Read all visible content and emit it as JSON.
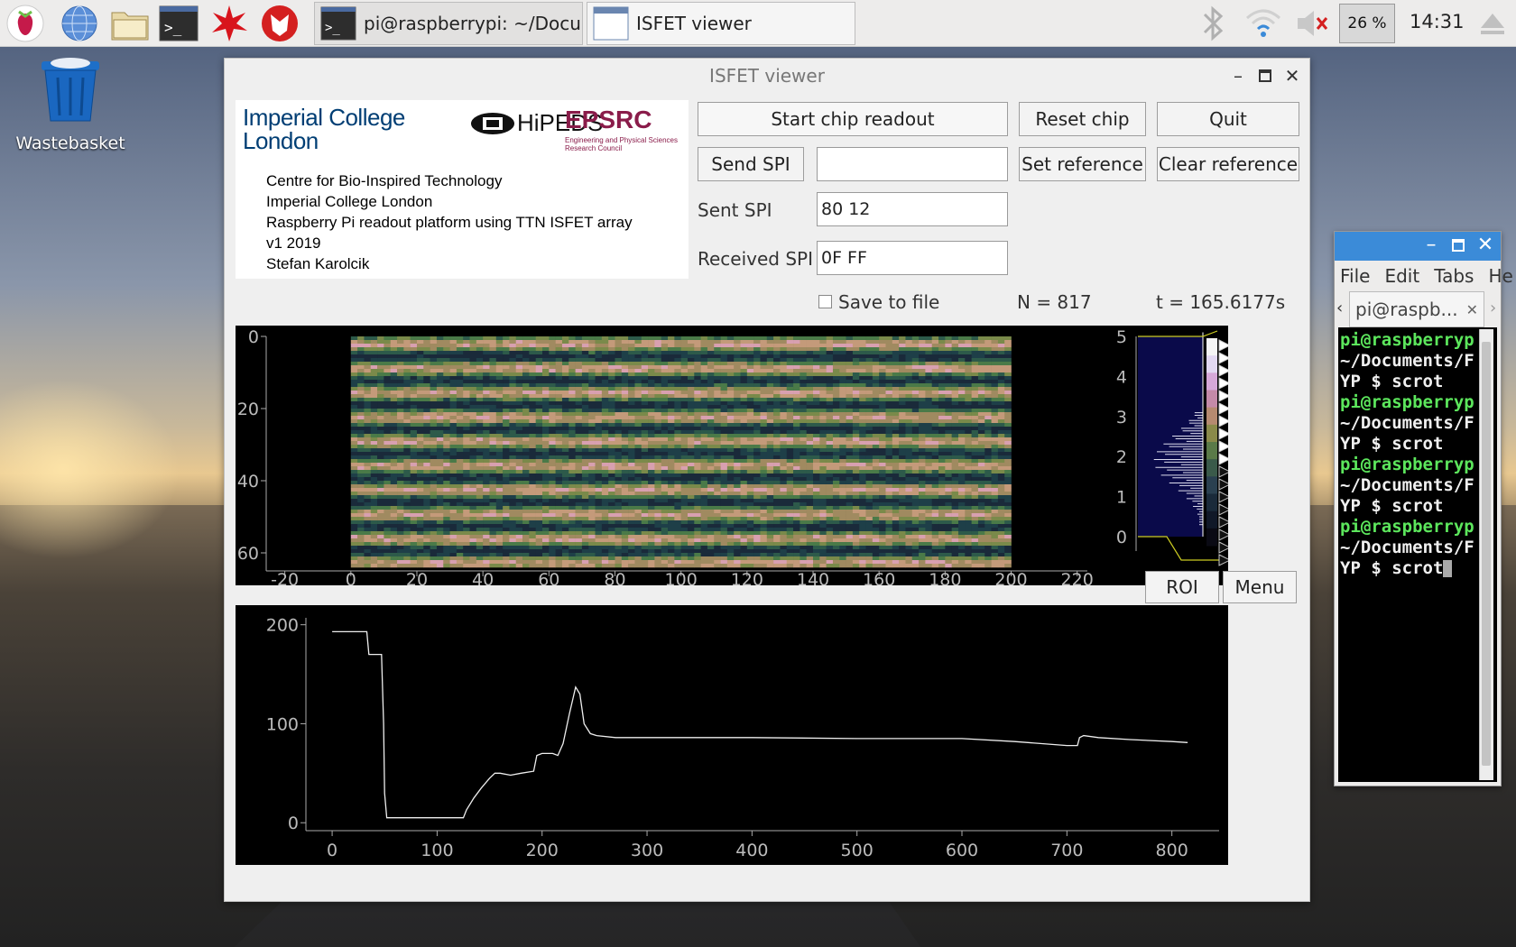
{
  "taskbar": {
    "tasks": [
      {
        "label": "pi@raspberrypi: ~/Docu..."
      },
      {
        "label": "ISFET viewer"
      }
    ],
    "cpu_label": "26 %",
    "clock": "14:31"
  },
  "desktop": {
    "wastebasket_label": "Wastebasket"
  },
  "window": {
    "title": "ISFET viewer",
    "logos": {
      "imperial_line1": "Imperial College",
      "imperial_line2": "London",
      "hipeds": "HiPEDS",
      "epsrc": "EPSRC",
      "epsrc_sub": "Engineering and Physical Sciences Research Council"
    },
    "info_lines": [
      "Centre for Bio-Inspired Technology",
      "Imperial College London",
      "Raspberry Pi readout platform using TTN ISFET array",
      "v1 2019",
      "Stefan Karolcik"
    ],
    "buttons": {
      "start": "Start chip readout",
      "reset": "Reset chip",
      "quit": "Quit",
      "send_spi": "Send SPI",
      "set_ref": "Set reference",
      "clear_ref": "Clear reference",
      "roi": "ROI",
      "menu": "Menu"
    },
    "fields": {
      "spi_input": "",
      "sent_label": "Sent SPI",
      "sent_value": "80 12",
      "received_label": "Received SPI",
      "received_value": "0F FF"
    },
    "save_label": "Save to file",
    "n_label": "N = 817",
    "t_label": "t = 165.6177s"
  },
  "chart_data": [
    {
      "type": "heatmap",
      "x_ticks": [
        "-20",
        "0",
        "20",
        "40",
        "60",
        "80",
        "100",
        "120",
        "140",
        "160",
        "180",
        "200",
        "220"
      ],
      "y_ticks": [
        "0",
        "20",
        "40",
        "60"
      ],
      "xlim": [
        -24,
        222
      ],
      "ylim": [
        0,
        64
      ],
      "image_extent": {
        "x": [
          0,
          200
        ],
        "y": [
          0,
          64
        ]
      },
      "colorbar_ticks": [
        "0",
        "1",
        "2",
        "3",
        "4",
        "5"
      ],
      "colorbar_range": [
        0,
        5
      ]
    },
    {
      "type": "line",
      "x_ticks": [
        "0",
        "100",
        "200",
        "300",
        "400",
        "500",
        "600",
        "700",
        "800"
      ],
      "y_ticks": [
        "0",
        "100",
        "200"
      ],
      "xlim": [
        -25,
        845
      ],
      "ylim": [
        -8,
        207
      ],
      "x": [
        0,
        33,
        35,
        47,
        49,
        50,
        52,
        60,
        80,
        100,
        120,
        125,
        128,
        135,
        142,
        150,
        155,
        160,
        170,
        180,
        192,
        195,
        200,
        210,
        215,
        220,
        226,
        232,
        236,
        240,
        246,
        252,
        270,
        300,
        400,
        500,
        600,
        650,
        700,
        710,
        712,
        716,
        730,
        760,
        800,
        815
      ],
      "values": [
        193,
        193,
        170,
        170,
        100,
        30,
        5,
        5,
        5,
        5,
        5,
        5,
        13,
        25,
        35,
        45,
        50,
        50,
        48,
        50,
        52,
        68,
        70,
        70,
        68,
        80,
        110,
        137,
        130,
        100,
        90,
        88,
        86,
        86,
        86,
        85,
        85,
        82,
        78,
        78,
        86,
        88,
        86,
        84,
        82,
        81
      ]
    }
  ],
  "terminal": {
    "menu": [
      "File",
      "Edit",
      "Tabs",
      "He"
    ],
    "tab_label": "pi@raspb...",
    "lines": [
      {
        "text": "pi@raspberryp",
        "color": "green"
      },
      {
        "text": "~/Documents/F",
        "color": "white"
      },
      {
        "text": "YP $ scrot",
        "color": "white"
      },
      {
        "text": "pi@raspberryp",
        "color": "green"
      },
      {
        "text": "~/Documents/F",
        "color": "white"
      },
      {
        "text": "YP $ scrot",
        "color": "white"
      },
      {
        "text": "pi@raspberryp",
        "color": "green"
      },
      {
        "text": "~/Documents/F",
        "color": "white"
      },
      {
        "text": "YP $ scrot",
        "color": "white"
      },
      {
        "text": "pi@raspberryp",
        "color": "green"
      },
      {
        "text": "~/Documents/F",
        "color": "white"
      },
      {
        "text": "YP $ scrot",
        "color": "white"
      }
    ]
  }
}
